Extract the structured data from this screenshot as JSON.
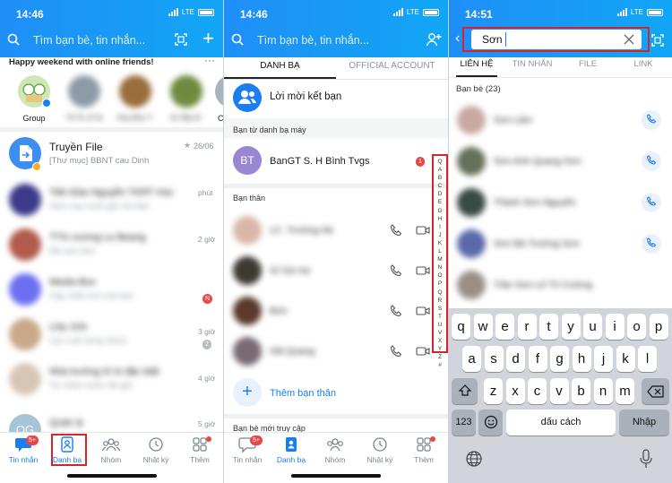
{
  "panel1": {
    "status_time": "14:46",
    "network": "LTE",
    "search_placeholder": "Tìm bạn bè, tin nhắn...",
    "banner_text": "Happy weekend with online friends!",
    "more_label": "···",
    "stories": [
      {
        "label": "Group"
      },
      {
        "label": "Tô Th..ã Tạ"
      },
      {
        "label": "Huy Đức T."
      },
      {
        "label": "ốc Hậu Đ."
      },
      {
        "label": "C"
      }
    ],
    "conversations": [
      {
        "name": "Truyền File",
        "preview": "[Thư mục] BBNT cau Dinh",
        "time": "26/06",
        "pinned": true
      },
      {
        "name": "Tiến Đào Nguyễn TKRT Học",
        "preview": "Hôm nay mình gửi chị bản",
        "time": "phút",
        "blurred": true
      },
      {
        "name": "TTG xương Le Beang",
        "preview": "Đã xem ảnh",
        "time": "2 giờ",
        "blurred": true
      },
      {
        "name": "Media Box",
        "preview": "Cập nhật mới của bạn",
        "time": "",
        "badge": "N",
        "blurred": true
      },
      {
        "name": "Lớp 10A",
        "preview": "Lần cuối trong nhóm",
        "time": "3 giờ",
        "badge": "2",
        "blurred": true
      },
      {
        "name": "Nhà trường Kì ki đặc biệt",
        "preview": "Tin nhắn nhóm đã gửi",
        "time": "4 giờ",
        "blurred": true
      },
      {
        "name": "Quản lý",
        "preview": "Đã gửi một tin",
        "time": "5 giờ",
        "badge_initials": "QG",
        "blurred": true
      }
    ],
    "tabs": [
      {
        "label": "Tin nhắn",
        "badge": "5+"
      },
      {
        "label": "Danh bạ",
        "active": true
      },
      {
        "label": "Nhóm"
      },
      {
        "label": "Nhật ký"
      },
      {
        "label": "Thêm"
      }
    ]
  },
  "panel2": {
    "status_time": "14:46",
    "network": "LTE",
    "search_placeholder": "Tìm bạn bè, tin nhắn...",
    "top_tabs": [
      {
        "label": "DANH BẠ",
        "active": true
      },
      {
        "label": "OFFICIAL ACCOUNT"
      }
    ],
    "friend_requests_label": "Lời mời kết bạn",
    "phonebook_header": "Bạn từ danh bạ máy",
    "phonebook_contact": {
      "initials": "BT",
      "name": "BanGT S. H Bình Tvgs",
      "badge": "1"
    },
    "close_friends_header": "Bạn thân",
    "close_friends": [
      {
        "name": "LC. Trường Hà"
      },
      {
        "name": "Gì Gà mẹ"
      },
      {
        "name": "Đức"
      },
      {
        "name": "Hải Quang"
      }
    ],
    "add_close_friend": "Thêm bạn thân",
    "recent_header": "Bạn bè mới truy cập",
    "alphabet": [
      "Q",
      "A",
      "B",
      "C",
      "D",
      "E",
      "G",
      "H",
      "I",
      "J",
      "K",
      "L",
      "M",
      "N",
      "O",
      "P",
      "Q",
      "R",
      "S",
      "T",
      "U",
      "V",
      "X",
      "Y",
      "Z",
      "#"
    ],
    "tabs": [
      {
        "label": "Tin nhắn",
        "badge": "5+"
      },
      {
        "label": "Danh bạ",
        "active": true
      },
      {
        "label": "Nhóm"
      },
      {
        "label": "Nhật ký"
      },
      {
        "label": "Thêm"
      }
    ]
  },
  "panel3": {
    "status_time": "14:51",
    "network": "LTE",
    "search_value": "Sơn",
    "tabs": [
      {
        "label": "LIÊN HỆ",
        "active": true
      },
      {
        "label": "TIN NHẮN"
      },
      {
        "label": "FILE"
      },
      {
        "label": "LINK"
      }
    ],
    "friends_header": "Bạn bè (23)",
    "results": [
      {
        "name": "Sơn Lâm"
      },
      {
        "name": "Sơn Anh Quang Sơn"
      },
      {
        "name": "Thành Sơn Nguyên"
      },
      {
        "name": "Sơn Bá Trường Sơn"
      },
      {
        "name": "Trần Sơn Lê Trí Cường"
      }
    ],
    "keyboard": {
      "row1": [
        "q",
        "w",
        "e",
        "r",
        "t",
        "y",
        "u",
        "i",
        "o",
        "p"
      ],
      "row2": [
        "a",
        "s",
        "d",
        "f",
        "g",
        "h",
        "j",
        "k",
        "l"
      ],
      "row3": [
        "z",
        "x",
        "c",
        "v",
        "b",
        "n",
        "m"
      ],
      "numbers_key": "123",
      "space_label": "dấu cách",
      "return_label": "Nhập"
    }
  },
  "colors": {
    "brand_blue": "#1a7ef3",
    "highlight_red": "#d4242c",
    "badge_red": "#e54848"
  }
}
